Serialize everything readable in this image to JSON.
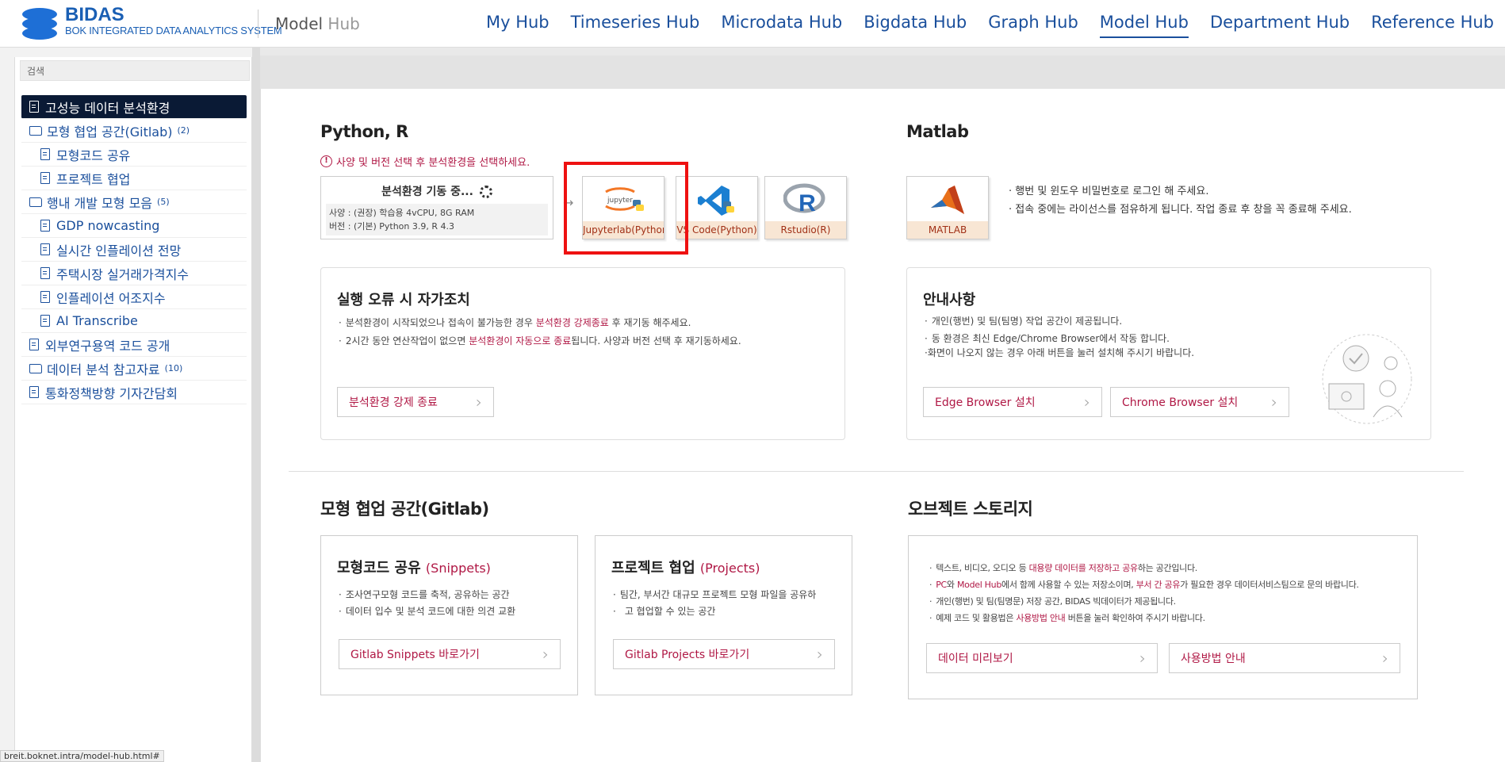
{
  "header": {
    "brand_title": "BIDAS",
    "brand_subtitle": "BOK INTEGRATED DATA ANALYTICS SYSTEM",
    "section_title_main": "Model",
    "section_title_hub": "Hub",
    "nav": [
      "My Hub",
      "Timeseries Hub",
      "Microdata Hub",
      "Bigdata Hub",
      "Graph Hub",
      "Model Hub",
      "Department Hub",
      "Reference Hub"
    ],
    "active_nav": "Model Hub"
  },
  "sidebar": {
    "search_placeholder": "검색",
    "items": [
      {
        "label": "고성능 데이터 분석환경",
        "type": "doc",
        "level": "top",
        "active": true
      },
      {
        "label": "모형 협업 공간(Gitlab)",
        "count": "(2)",
        "type": "folder",
        "level": "top"
      },
      {
        "label": "모형코드 공유",
        "type": "doc",
        "level": "child"
      },
      {
        "label": "프로젝트 협업",
        "type": "doc",
        "level": "child"
      },
      {
        "label": "행내 개발 모형 모음",
        "count": "(5)",
        "type": "folder",
        "level": "top"
      },
      {
        "label": "GDP nowcasting",
        "type": "doc",
        "level": "child"
      },
      {
        "label": "실시간 인플레이션 전망",
        "type": "doc",
        "level": "child"
      },
      {
        "label": "주택시장 실거래가격지수",
        "type": "doc",
        "level": "child"
      },
      {
        "label": "인플레이션 어조지수",
        "type": "doc",
        "level": "child"
      },
      {
        "label": "AI Transcribe",
        "type": "doc",
        "level": "child"
      },
      {
        "label": "외부연구용역 코드 공개",
        "type": "doc",
        "level": "top"
      },
      {
        "label": "데이터 분석 참고자료",
        "count": "(10)",
        "type": "folder",
        "level": "top"
      },
      {
        "label": "통화정책방향 기자간담회",
        "type": "doc",
        "level": "top"
      }
    ]
  },
  "python": {
    "title": "Python, R",
    "warning": "사양 및 버전 선택 후 분석환경을 선택하세요.",
    "status_title": "분석환경 기동 중...",
    "spec_line": "사양 : (권장) 학습용 4vCPU, 8G RAM",
    "version_line": "버전 : (기본) Python 3.9, R 4.3",
    "envs": [
      {
        "label": "Jupyterlab(Python)",
        "icon": "jupyter-icon"
      },
      {
        "label": "VS Code(Python)",
        "icon": "vscode-icon"
      },
      {
        "label": "Rstudio(R)",
        "icon": "r-icon"
      }
    ]
  },
  "matlab": {
    "title": "Matlab",
    "label": "MATLAB",
    "notes": [
      "행번 및 윈도우 비밀번호로 로그인 해 주세요.",
      "접속 중에는 라이선스를 점유하게 됩니다. 작업 종료 후 창을 꼭 종료해 주세요."
    ]
  },
  "error_panel": {
    "title": "실행 오류 시 자가조치",
    "line1_a": "분석환경이 시작되었으나 접속이 불가능한 경우 ",
    "line1_hl": "분석환경 강제종료",
    "line1_b": " 후 재기동 해주세요.",
    "line2_a": "2시간 동안 연산작업이 없으면 ",
    "line2_hl": "분석환경이 자동으로 종료",
    "line2_b": "됩니다. 사양과 버전 선택 후 재기동하세요.",
    "button": "분석환경 강제 종료"
  },
  "notice_panel": {
    "title": "안내사항",
    "line1": "개인(행번) 및 팀(팀명) 작업 공간이 제공됩니다.",
    "line2": "동 환경은 최신 Edge/Chrome Browser에서 작동 합니다.",
    "line3": "화면이 나오지 않는 경우 아래 버튼을 눌러 설치해 주시기 바랍니다.",
    "edge_button": "Edge Browser 설치",
    "chrome_button": "Chrome Browser 설치"
  },
  "gitlab": {
    "title": "모형 협업 공간(Gitlab)",
    "snippets_title": "모형코드 공유",
    "snippets_sub": "(Snippets)",
    "snippets_lines": [
      "조사연구모형 코드를 축적, 공유하는 공간",
      "데이터 입수 및 분석 코드에 대한 의견 교환"
    ],
    "snippets_button": "Gitlab Snippets 바로가기",
    "projects_title": "프로젝트 협업",
    "projects_sub": "(Projects)",
    "projects_line1": "팀간, 부서간 대규모 프로젝트 모형 파일을 공유하",
    "projects_line2": "고 협업할 수 있는 공간",
    "projects_button": "Gitlab Projects 바로가기"
  },
  "storage": {
    "title": "오브젝트 스토리지",
    "l1_a": "텍스트, 비디오, 오디오 등 ",
    "l1_hl": "대용량 데이터를 저장하고 공유",
    "l1_b": "하는 공간입니다.",
    "l2_hl1": "PC",
    "l2_a": "와 ",
    "l2_hl2": "Model Hub",
    "l2_b": "에서 함께 사용할 수 있는 저장소이며, ",
    "l2_hl3": "부서 간 공유",
    "l2_c": "가 필요한 경우 데이터서비스팀으로 문의 바랍니다.",
    "l3": "개인(행번) 및 팀(팀명문) 저장 공간, BIDAS 빅데이터가 제공됩니다.",
    "l4_a": "예제 코드 및 활용법은 ",
    "l4_hl": "사용방법 안내",
    "l4_b": " 버튼을 눌러 확인하여 주시기 바랍니다.",
    "preview_button": "데이터 미리보기",
    "guide_button": "사용방법 안내"
  },
  "status_url": "breit.boknet.intra/model-hub.html#"
}
